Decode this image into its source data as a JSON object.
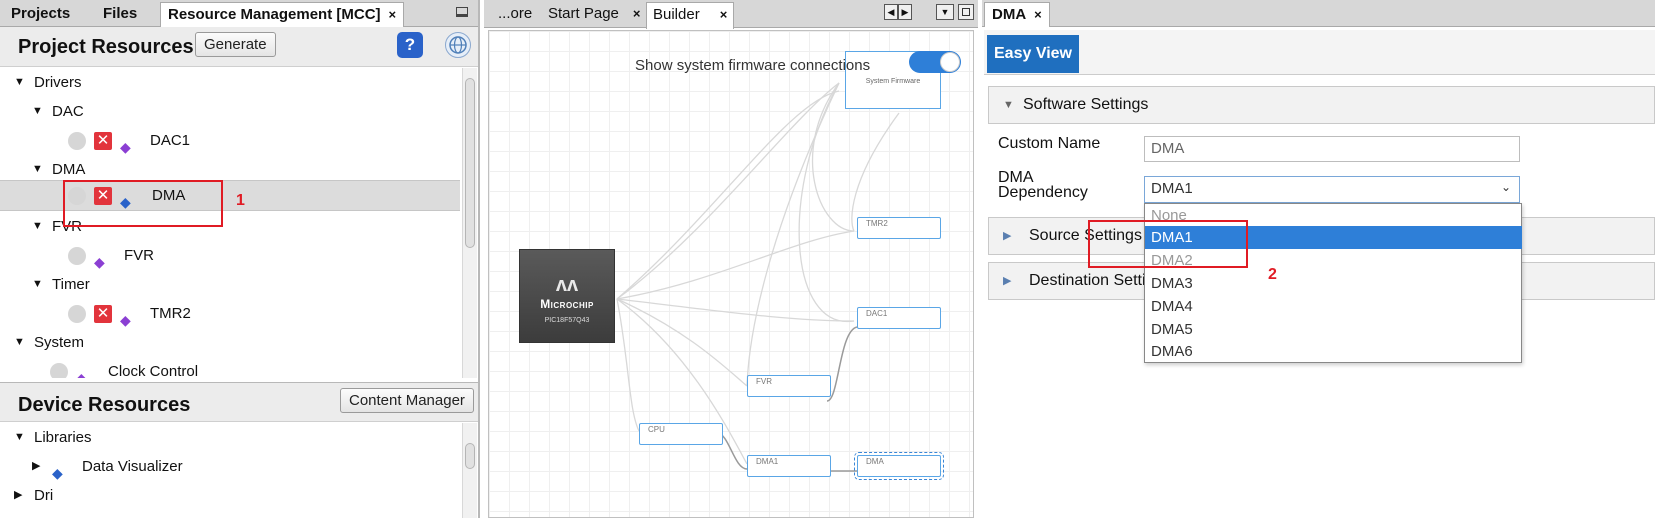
{
  "left_tabs": [
    {
      "label": "Projects"
    },
    {
      "label": "Files"
    },
    {
      "label": "Resource Management [MCC]",
      "close": "×"
    }
  ],
  "project_resources": {
    "title": "Project Resources",
    "generate_label": "Generate",
    "tree": {
      "drivers": "Drivers",
      "dac": "DAC",
      "dac1": "DAC1",
      "dma": "DMA",
      "dma_item": "DMA",
      "fvr": "FVR",
      "fvr_item": "FVR",
      "timer": "Timer",
      "tmr2": "TMR2",
      "system": "System",
      "clock_control": "Clock Control"
    }
  },
  "device_resources": {
    "title": "Device Resources",
    "content_manager_label": "Content Manager",
    "tree": {
      "libraries": "Libraries",
      "data_visualizer": "Data Visualizer",
      "drivers_partial": "Dri"
    }
  },
  "annotations": {
    "label1": "1",
    "label2": "2"
  },
  "mid_tabs": [
    {
      "label": "...ore"
    },
    {
      "label": "Start Page",
      "close": "×"
    },
    {
      "label": "Builder",
      "close": "×"
    }
  ],
  "builder": {
    "toggle_label": "Show system firmware connections",
    "toggle_on": true,
    "chip_brand": "Microchip",
    "chip_part": "PIC18F57Q43",
    "nodes": {
      "system_firmware": "System Firmware",
      "tmr2": "TMR2",
      "dac1": "DAC1",
      "fvr": "FVR",
      "cpu": "CPU",
      "dma1": "DMA1",
      "dma": "DMA"
    }
  },
  "right_panel": {
    "tab_label": "DMA",
    "tab_close": "×",
    "easy_view_label": "Easy View",
    "software_settings_label": "Software Settings",
    "custom_name_label": "Custom Name",
    "custom_name_value": "DMA",
    "dependency_label_line1": "DMA",
    "dependency_label_line2": "Dependency",
    "dependency_value": "DMA1",
    "dependency_options": [
      "None",
      "DMA1",
      "DMA2",
      "DMA3",
      "DMA4",
      "DMA5",
      "DMA6"
    ],
    "source_settings_label": "Source Settings",
    "destination_settings_label": "Destination Settings"
  },
  "colors": {
    "accent": "#2e7fd8",
    "annotation": "#e01b24",
    "easy_view_bg": "#1f6fbf"
  }
}
